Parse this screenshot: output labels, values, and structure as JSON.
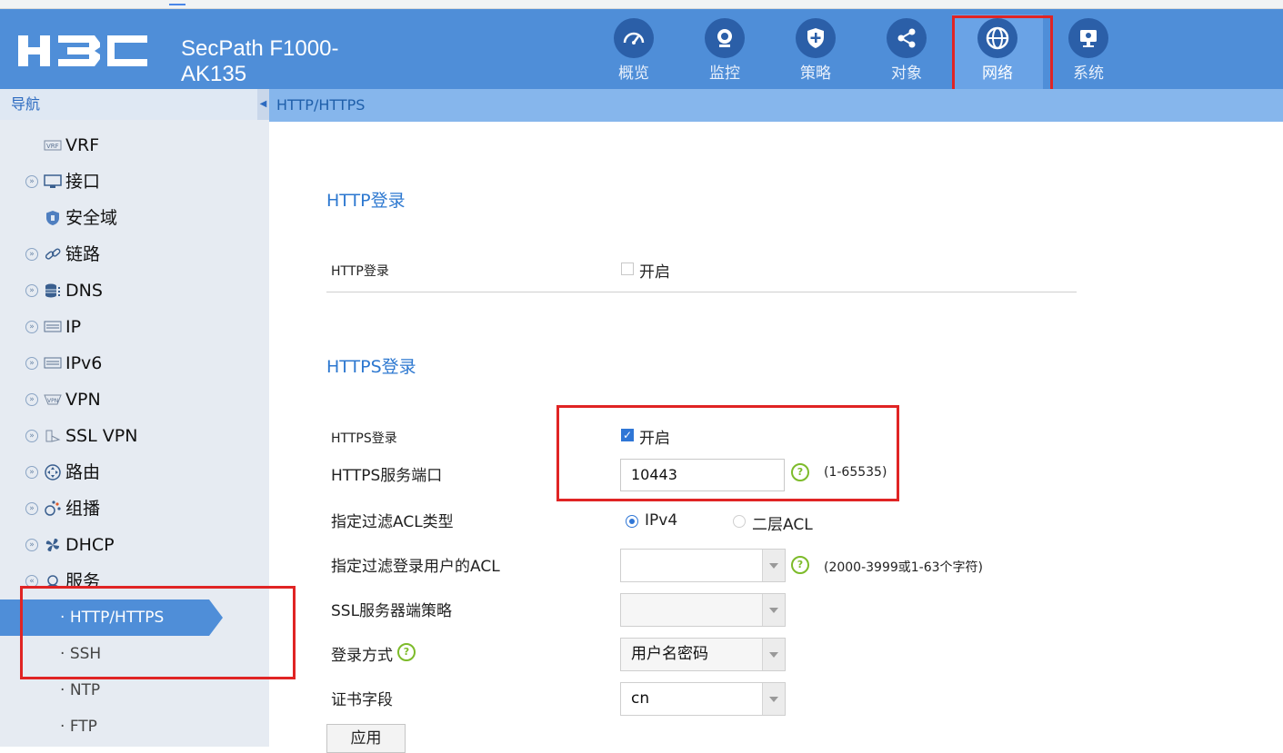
{
  "header": {
    "product_line1": "SecPath F1000-",
    "product_line2": "AK135",
    "nav": [
      {
        "label": "概览",
        "icon": "dashboard-icon"
      },
      {
        "label": "监控",
        "icon": "camera-icon"
      },
      {
        "label": "策略",
        "icon": "shield-icon"
      },
      {
        "label": "对象",
        "icon": "share-icon"
      },
      {
        "label": "网络",
        "icon": "globe-icon",
        "active": true
      },
      {
        "label": "系统",
        "icon": "monitor-icon"
      }
    ],
    "brand_color": "#4f8ed8"
  },
  "sidebar": {
    "title": "导航",
    "items": [
      {
        "label": "VRF",
        "icon": "vrf-icon",
        "expandable": false
      },
      {
        "label": "接口",
        "icon": "interface-icon",
        "expandable": true
      },
      {
        "label": "安全域",
        "icon": "security-zone-icon",
        "expandable": false
      },
      {
        "label": "链路",
        "icon": "link-icon",
        "expandable": true
      },
      {
        "label": "DNS",
        "icon": "database-icon",
        "expandable": true
      },
      {
        "label": "IP",
        "icon": "ip-icon",
        "expandable": true
      },
      {
        "label": "IPv6",
        "icon": "ipv6-icon",
        "expandable": true
      },
      {
        "label": "VPN",
        "icon": "vpn-icon",
        "expandable": true
      },
      {
        "label": "SSL VPN",
        "icon": "ssl-vpn-icon",
        "expandable": true
      },
      {
        "label": "路由",
        "icon": "route-icon",
        "expandable": true
      },
      {
        "label": "组播",
        "icon": "multicast-icon",
        "expandable": true
      },
      {
        "label": "DHCP",
        "icon": "dhcp-icon",
        "expandable": true
      },
      {
        "label": "服务",
        "icon": "service-icon",
        "expandable": true,
        "expanded": true
      }
    ],
    "sub_items": [
      {
        "label": "HTTP/HTTPS",
        "active": true
      },
      {
        "label": "SSH"
      },
      {
        "label": "NTP"
      },
      {
        "label": "FTP"
      }
    ]
  },
  "breadcrumb": "HTTP/HTTPS",
  "http_section": {
    "title": "HTTP登录",
    "login_label": "HTTP登录",
    "enable_label": "开启",
    "enabled": false
  },
  "https_section": {
    "title": "HTTPS登录",
    "login_label": "HTTPS登录",
    "enable_label": "开启",
    "enabled": true,
    "port_label": "HTTPS服务端口",
    "port_value": "10443",
    "port_hint": "(1-65535)",
    "acl_type_label": "指定过滤ACL类型",
    "acl_type_options": [
      "IPv4",
      "二层ACL"
    ],
    "acl_type_selected": "IPv4",
    "acl_label": "指定过滤登录用户的ACL",
    "acl_value": "",
    "acl_hint": "(2000-3999或1-63个字符)",
    "ssl_policy_label": "SSL服务器端策略",
    "ssl_policy_value": "",
    "login_method_label": "登录方式",
    "login_method_value": "用户名密码",
    "cert_field_label": "证书字段",
    "cert_field_value": "cn"
  },
  "apply_label": "应用"
}
